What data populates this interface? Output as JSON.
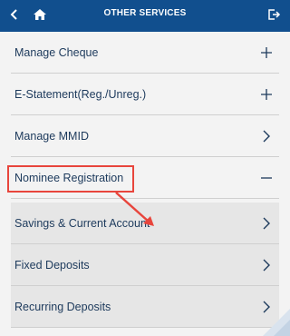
{
  "header": {
    "title": "OTHER SERVICES",
    "back_icon": "chevron-left-icon",
    "home_icon": "home-icon",
    "logout_icon": "logout-icon"
  },
  "menu": {
    "items": [
      {
        "label": "Manage Cheque",
        "icon": "plus-icon"
      },
      {
        "label": "E-Statement(Reg./Unreg.)",
        "icon": "plus-icon"
      },
      {
        "label": "Manage MMID",
        "icon": "chevron-right-icon"
      },
      {
        "label": "Nominee Registration",
        "icon": "minus-icon"
      }
    ],
    "sub_items": [
      {
        "label": "Savings & Current Account",
        "icon": "chevron-right-icon"
      },
      {
        "label": "Fixed Deposits",
        "icon": "chevron-right-icon"
      },
      {
        "label": "Recurring Deposits",
        "icon": "chevron-right-icon"
      }
    ]
  },
  "colors": {
    "header_bg": "#114f8e",
    "text": "#1d3a5c",
    "highlight": "#e8453c"
  }
}
